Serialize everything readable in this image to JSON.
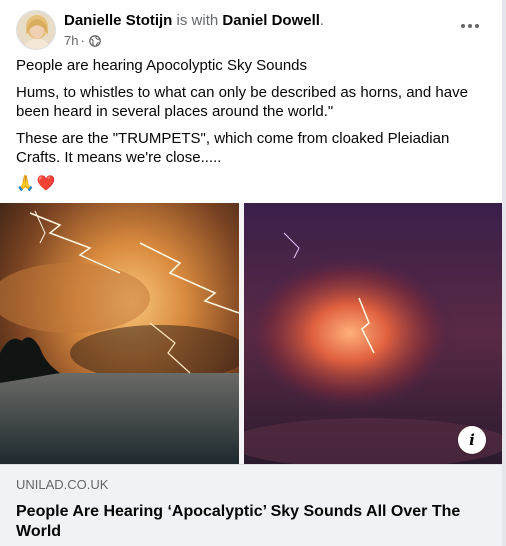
{
  "post": {
    "author": "Danielle Stotijn",
    "with_text": "is with",
    "tagged": "Daniel Dowell",
    "tagged_suffix": ".",
    "time": "7h",
    "time_sep": "·",
    "audience_icon": "globe-icon",
    "more_icon": "more-options-icon",
    "paragraphs": [
      "People are hearing Apocolyptic Sky Sounds",
      "Hums, to whistles to what can only be described as horns, and have been heard in several places around the world.\"",
      "These are the \"TRUMPETS\", which come from cloaked Pleiadian Crafts. It means we're close....."
    ],
    "emojis": [
      "🙏",
      "❤️"
    ]
  },
  "link": {
    "domain": "UNILAD.CO.UK",
    "title": "People Are Hearing ‘Apocalyptic’ Sky Sounds All Over The World",
    "info_label": "i"
  },
  "colors": {
    "text_primary": "#050505",
    "text_secondary": "#65676b",
    "preview_bg": "#f0f2f5"
  }
}
